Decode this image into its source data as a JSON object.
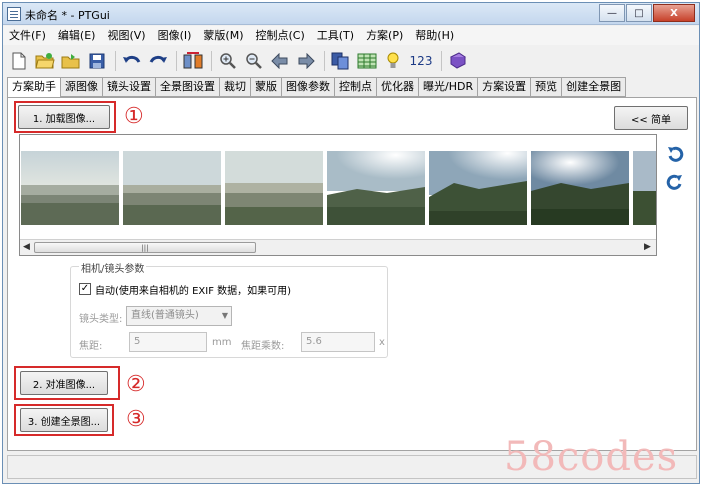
{
  "window": {
    "title": "未命名 * - PTGui",
    "controls": {
      "minimize": "—",
      "maximize": "□",
      "close": "X"
    }
  },
  "menu": [
    "文件(F)",
    "编辑(E)",
    "视图(V)",
    "图像(I)",
    "蒙版(M)",
    "控制点(C)",
    "工具(T)",
    "方案(P)",
    "帮助(H)"
  ],
  "toolbar": {
    "numbering_label": "123"
  },
  "tabs": [
    "方案助手",
    "源图像",
    "镜头设置",
    "全景图设置",
    "裁切",
    "蒙版",
    "图像参数",
    "控制点",
    "优化器",
    "曝光/HDR",
    "方案设置",
    "预览",
    "创建全景图"
  ],
  "active_tab": 0,
  "buttons": {
    "load_images": "1. 加载图像...",
    "simple": "<< 简单",
    "align_images": "2. 对准图像...",
    "create_panorama": "3. 创建全景图..."
  },
  "annotations": [
    "①",
    "②",
    "③"
  ],
  "scrollbar": {
    "left_arrow": "◀",
    "right_arrow": "▶",
    "grip": "|||"
  },
  "camera_params": {
    "title": "相机/镜头参数",
    "auto_checked": true,
    "check_mark": "✓",
    "auto_label": "自动(使用来自相机的 EXIF 数据，如果可用)",
    "lens_type_label": "镜头类型:",
    "lens_type_value": "直线(普通镜头)",
    "dropdown_arrow": "▼",
    "focal_label": "焦距:",
    "focal_value": "5",
    "focal_unit": "mm",
    "crop_label": "焦距乘数:",
    "crop_value": "5.6",
    "crop_unit": "x"
  },
  "watermark": "58codes",
  "colors": {
    "highlight": "#d62a2a",
    "rotate_icon": "#2563a8"
  }
}
